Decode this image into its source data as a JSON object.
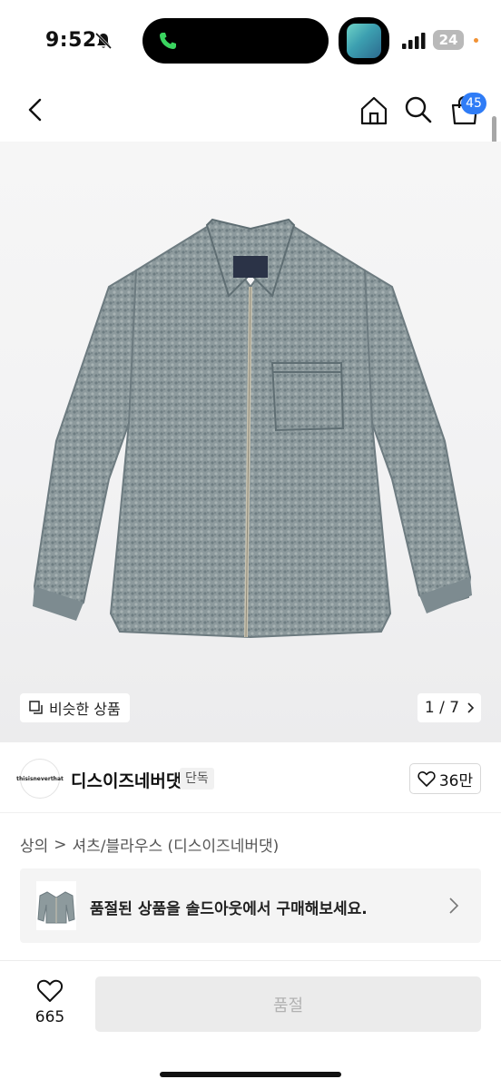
{
  "status_bar": {
    "time": "9:52",
    "battery": "24",
    "icons": [
      "bell-slash-icon",
      "phone-icon",
      "signal-icon",
      "battery-icon"
    ]
  },
  "nav": {
    "cart_count": "45",
    "icons": [
      "chevron-left-icon",
      "home-icon",
      "search-icon",
      "cart-icon"
    ]
  },
  "gallery": {
    "similar_label": "비슷한 상품",
    "page_indicator": "1 / 7"
  },
  "brand": {
    "name": "디스이즈네버댓",
    "tag": "단독",
    "logo_text": "thisisneverthat",
    "likes": "36만"
  },
  "breadcrumb": {
    "category": "상의",
    "separator": ">",
    "subcategory": "셔츠/블라우스 (디스이즈네버댓)"
  },
  "soldout_banner": {
    "text": "품절된 상품을 솔드아웃에서 구매해보세요."
  },
  "bottom_bar": {
    "wish_count": "665",
    "buy_label": "품절"
  },
  "colors": {
    "badge": "#2f7cf6",
    "jacket": "#8b989b",
    "disabled": "#ebebeb"
  }
}
